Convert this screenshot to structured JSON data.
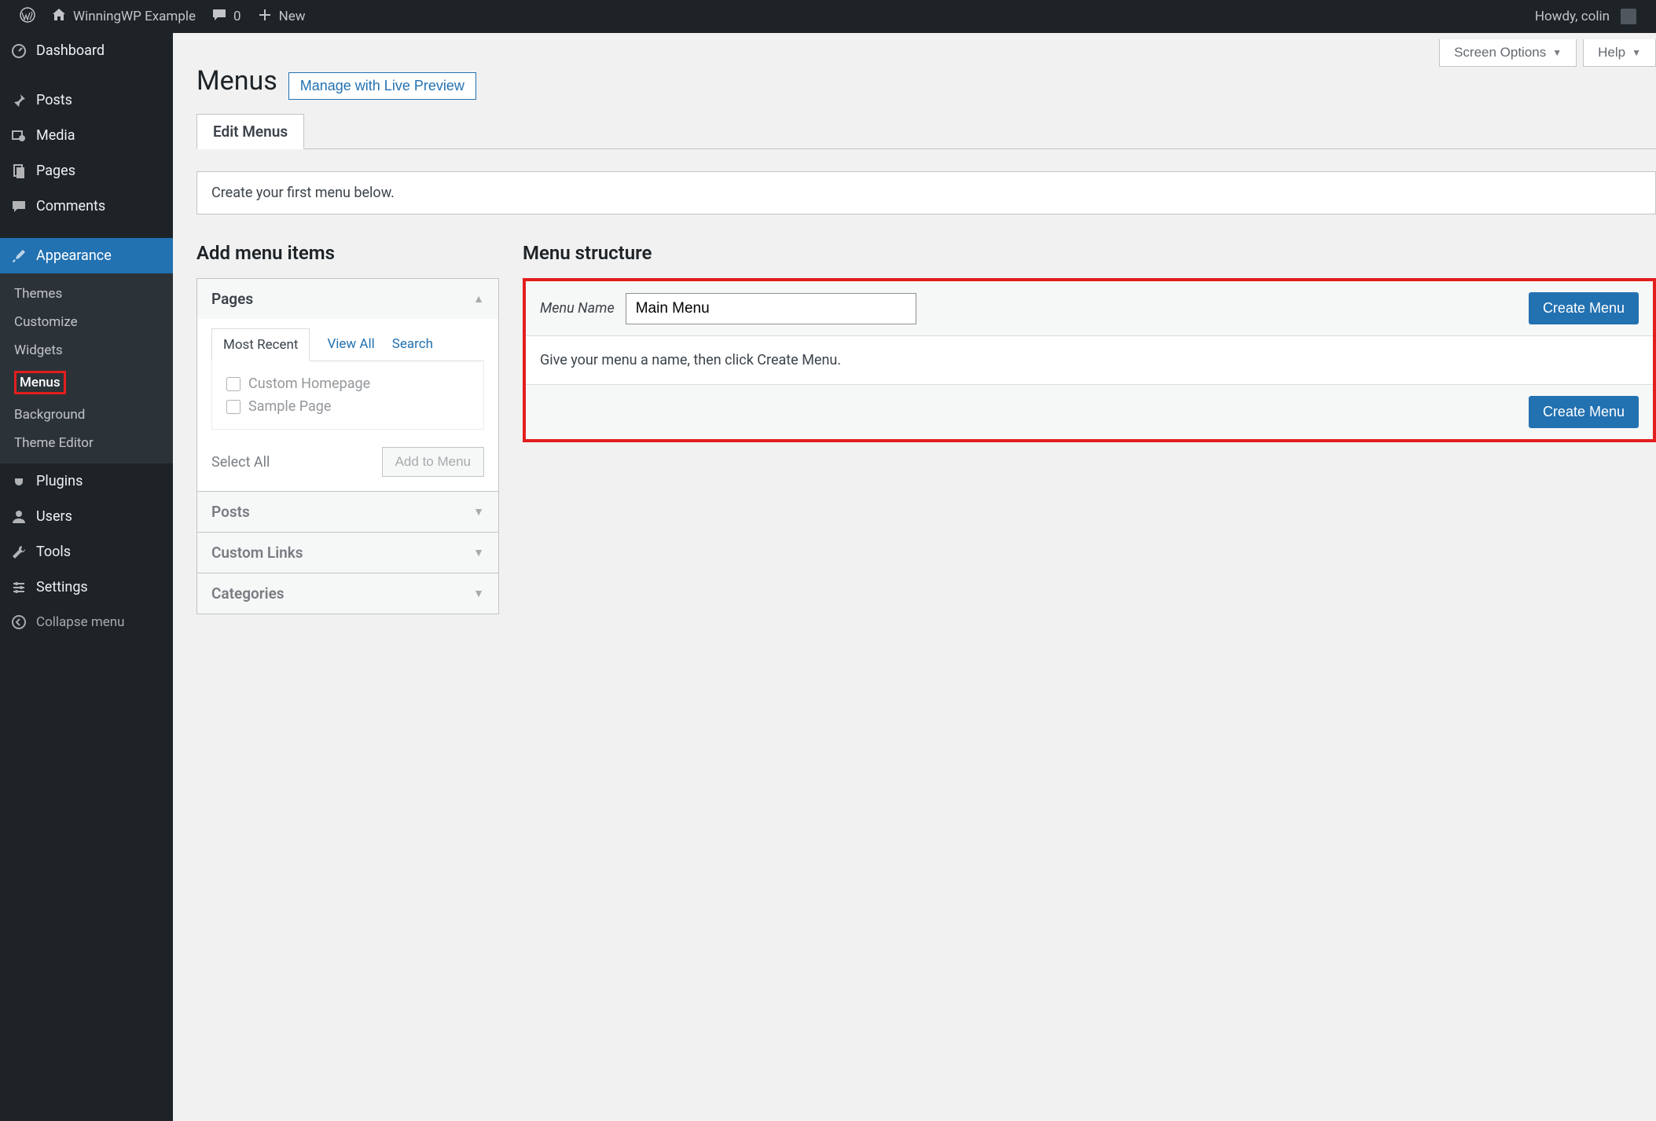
{
  "adminbar": {
    "site_name": "WinningWP Example",
    "comments_count": "0",
    "new_label": "New",
    "howdy": "Howdy, colin"
  },
  "sidebar": {
    "dashboard": "Dashboard",
    "posts": "Posts",
    "media": "Media",
    "pages": "Pages",
    "comments": "Comments",
    "appearance": "Appearance",
    "appearance_sub": {
      "themes": "Themes",
      "customize": "Customize",
      "widgets": "Widgets",
      "menus": "Menus",
      "background": "Background",
      "theme_editor": "Theme Editor"
    },
    "plugins": "Plugins",
    "users": "Users",
    "tools": "Tools",
    "settings": "Settings",
    "collapse": "Collapse menu"
  },
  "top_buttons": {
    "screen_options": "Screen Options",
    "help": "Help"
  },
  "page": {
    "title": "Menus",
    "live_preview": "Manage with Live Preview",
    "tab_edit": "Edit Menus",
    "info": "Create your first menu below."
  },
  "add_items": {
    "heading": "Add menu items",
    "pages": {
      "title": "Pages",
      "tabs": {
        "recent": "Most Recent",
        "view_all": "View All",
        "search": "Search"
      },
      "items": [
        "Custom Homepage",
        "Sample Page"
      ],
      "select_all": "Select All",
      "add_btn": "Add to Menu"
    },
    "posts_title": "Posts",
    "custom_links_title": "Custom Links",
    "categories_title": "Categories"
  },
  "menu_structure": {
    "heading": "Menu structure",
    "name_label": "Menu Name",
    "name_value": "Main Menu",
    "create_btn": "Create Menu",
    "hint": "Give your menu a name, then click Create Menu."
  }
}
